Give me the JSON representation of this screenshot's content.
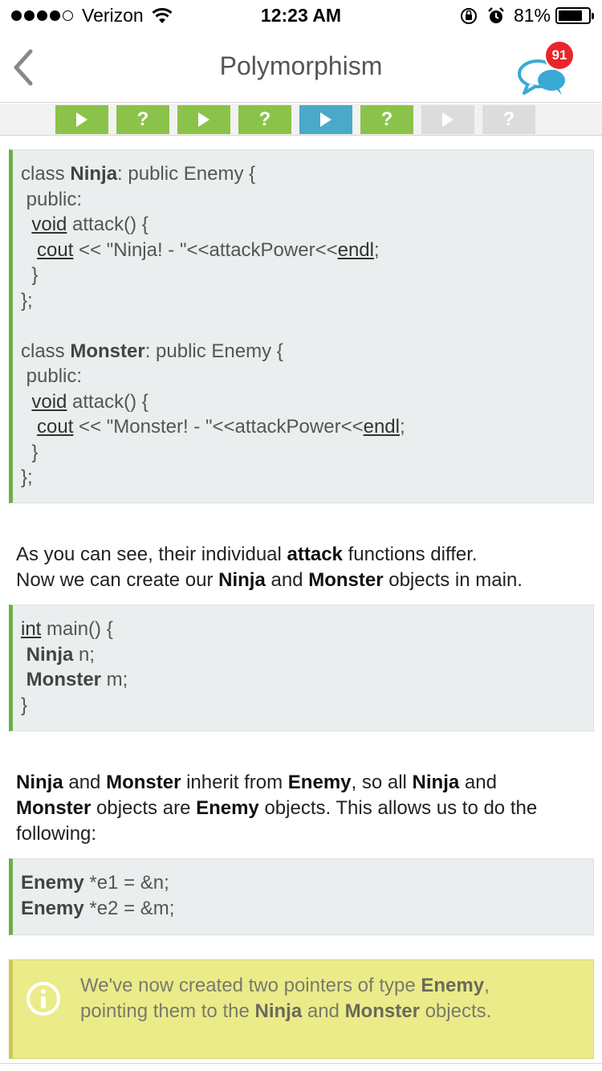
{
  "status": {
    "carrier": "Verizon",
    "time": "12:23 AM",
    "battery": "81%",
    "battery_level": 0.81
  },
  "nav": {
    "title": "Polymorphism",
    "badge_count": "91"
  },
  "progress": {
    "steps": [
      {
        "kind": "play",
        "state": "done",
        "color": "#8bc34a"
      },
      {
        "kind": "quiz",
        "state": "done",
        "color": "#8bc34a"
      },
      {
        "kind": "play",
        "state": "done",
        "color": "#8bc34a"
      },
      {
        "kind": "quiz",
        "state": "done",
        "color": "#8bc34a"
      },
      {
        "kind": "play",
        "state": "current",
        "color": "#4aa8c8"
      },
      {
        "kind": "quiz",
        "state": "done",
        "color": "#8bc34a"
      },
      {
        "kind": "play",
        "state": "locked",
        "color": "#dcdcdc"
      },
      {
        "kind": "quiz",
        "state": "locked",
        "color": "#dcdcdc"
      }
    ],
    "quiz_glyph": "?"
  },
  "code1": {
    "l1": [
      "class ",
      "Ninja",
      ": public Enemy {"
    ],
    "l2": " public:",
    "l3": [
      "void",
      " attack() {"
    ],
    "l4": [
      "cout",
      " << \"Ninja! - \"<<attackPower<<",
      "endl",
      ";"
    ],
    "l5": "  }",
    "l6": "};",
    "l7": [
      "class ",
      "Monster",
      ": public Enemy {"
    ],
    "l8": " public:",
    "l9": [
      "void",
      " attack() {"
    ],
    "l10": [
      "cout",
      " << \"Monster! - \"<<attackPower<<",
      "endl",
      ";"
    ],
    "l11": "  }",
    "l12": "};"
  },
  "para1": {
    "a": "As you can see, their individual ",
    "b": "attack",
    "c": " functions differ.",
    "d": "Now we can create our ",
    "e": "Ninja",
    "f": " and ",
    "g": "Monster",
    "h": " objects in main."
  },
  "code2": {
    "l1": [
      "int",
      " main() {"
    ],
    "l2": [
      "Ninja",
      " n;"
    ],
    "l3": [
      "Monster",
      " m;"
    ],
    "l4": "}"
  },
  "para2": {
    "a": "Ninja",
    "b": " and ",
    "c": "Monster",
    "d": " inherit from ",
    "e": "Enemy",
    "f": ", so all ",
    "g": "Ninja",
    "h": " and",
    "i": "Monster",
    "j": " objects are ",
    "k": "Enemy",
    "l": " objects. This allows us to do the",
    "m": "following:"
  },
  "code3": {
    "l1": [
      "Enemy",
      " *e1 = &n;"
    ],
    "l2": [
      "Enemy",
      " *e2 = &m;"
    ]
  },
  "note": {
    "a": "We've now created two pointers of type ",
    "b": "Enemy",
    "c": ",",
    "d": "pointing them to the ",
    "e": "Ninja",
    "f": " and ",
    "g": "Monster",
    "h": " objects."
  }
}
